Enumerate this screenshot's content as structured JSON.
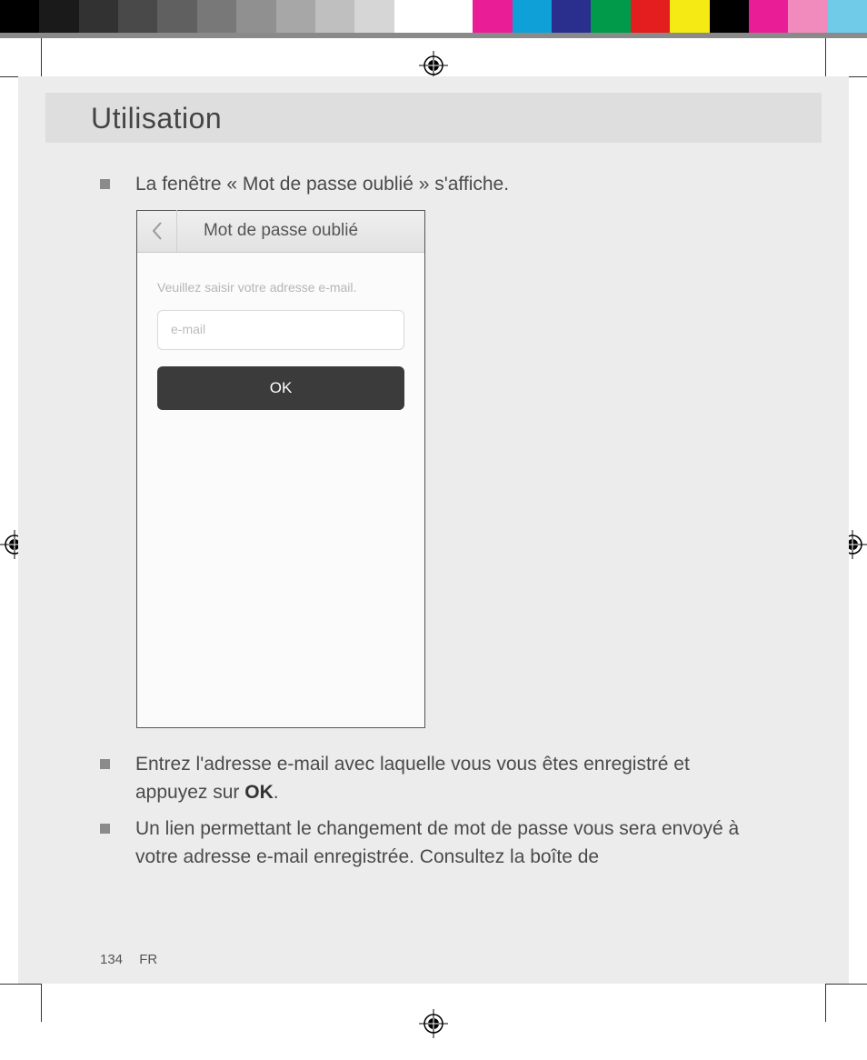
{
  "colorbar": {
    "grays": [
      "#000000",
      "#1a1a1a",
      "#323232",
      "#494949",
      "#606060",
      "#787878",
      "#909090",
      "#a7a7a7",
      "#bfbfbf",
      "#d6d6d6",
      "#ffffff"
    ],
    "colors": [
      "#ffffff",
      "#e91e97",
      "#0ea0d6",
      "#2a2f8e",
      "#009a4a",
      "#e41e1e",
      "#f5ea14",
      "#000000",
      "#e91e97",
      "#f18bbd",
      "#6fcbe8"
    ]
  },
  "heading": "Utilisation",
  "bullets": {
    "b1": "La fenêtre « Mot de passe oublié » s'affiche.",
    "b2_pre": "Entrez l'adresse e-mail avec laquelle vous vous êtes enregistré et appuyez sur ",
    "b2_bold": "OK",
    "b2_post": ".",
    "b3": "Un lien permettant le changement de mot de passe vous sera envoyé à votre adresse e-mail enregistrée. Consultez la boîte de"
  },
  "phone": {
    "title": "Mot de passe oublié",
    "instruction": "Veuillez saisir votre adresse e-mail.",
    "placeholder": "e-mail",
    "ok": "OK"
  },
  "footer": {
    "page": "134",
    "lang": "FR"
  }
}
